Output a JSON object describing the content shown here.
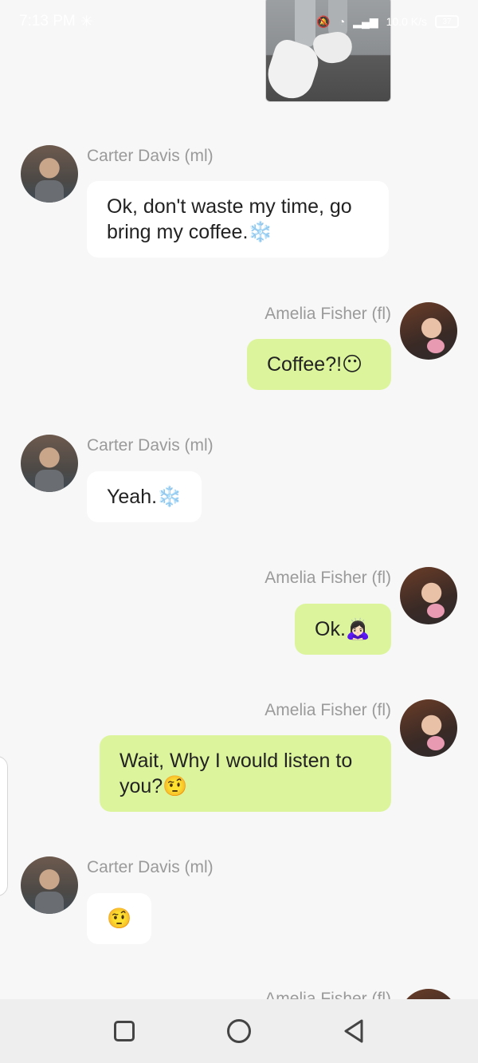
{
  "status_bar": {
    "time": "7:13 PM",
    "network_speed": "10.0 K/s",
    "battery": "37"
  },
  "messages": [
    {
      "sender": "Carter Davis (ml)",
      "text": "Ok, don't waste my time, go bring my coffee.❄️",
      "direction": "in"
    },
    {
      "sender": "Amelia Fisher (fl)",
      "text": "Coffee?!😶",
      "direction": "out"
    },
    {
      "sender": "Carter Davis (ml)",
      "text": "Yeah.❄️",
      "direction": "in"
    },
    {
      "sender": "Amelia Fisher (fl)",
      "text": "Ok.🙇🏻‍♀️",
      "direction": "out"
    },
    {
      "sender": "Amelia Fisher (fl)",
      "text": "Wait, Why I would listen to you?🤨",
      "direction": "out"
    },
    {
      "sender": "Carter Davis (ml)",
      "text": "🤨",
      "direction": "in"
    },
    {
      "sender": "Amelia Fisher (fl)",
      "text": "",
      "direction": "out"
    }
  ],
  "colors": {
    "background": "#f7f7f7",
    "incoming_bubble": "#ffffff",
    "outgoing_bubble": "#dcf59c",
    "sender_name": "#9a9a9a"
  },
  "icons": {
    "nav_recents": "square-icon",
    "nav_home": "circle-icon",
    "nav_back": "triangle-back-icon"
  }
}
